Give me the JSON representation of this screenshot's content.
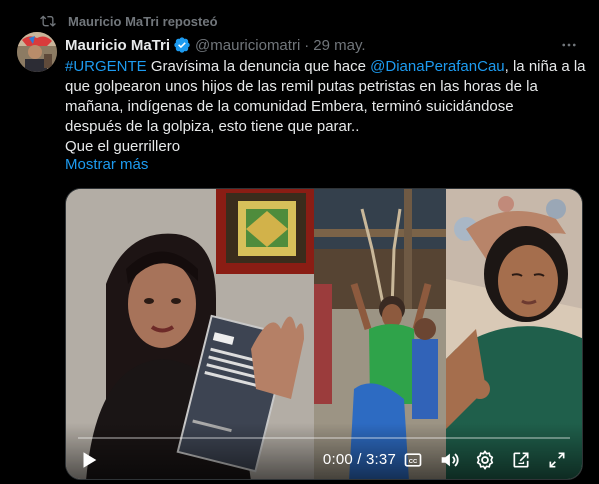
{
  "repost": {
    "text": "Mauricio MaTri reposteó",
    "icon": "repost-icon"
  },
  "tweet": {
    "author_name": "Mauricio MaTri",
    "handle": "@mauriciomatri",
    "separator": "·",
    "date": "29 may.",
    "verified": true,
    "lines": [
      {
        "parts": [
          {
            "text": "#URGENTE",
            "link": true
          },
          {
            "text": " Gravísima la denuncia que hace ",
            "link": false
          },
          {
            "text": "@DianaPerafanCau",
            "link": true
          },
          {
            "text": ", la niña a la",
            "link": false
          }
        ]
      },
      {
        "parts": [
          {
            "text": "que golpearon unos hijos de las remil putas petristas en las horas de la",
            "link": false
          }
        ]
      },
      {
        "parts": [
          {
            "text": "mañana, indígenas de la comunidad Embera, terminó suicidándose",
            "link": false
          }
        ]
      },
      {
        "parts": [
          {
            "text": "después de la golpiza, esto tiene que parar..",
            "link": false
          }
        ]
      },
      {
        "parts": [
          {
            "text": "Que el guerrillero",
            "link": false
          }
        ]
      }
    ],
    "show_more": "Mostrar más"
  },
  "media": {
    "book_title": "Constitución Política de Colombia",
    "book_brand": "LEGIS",
    "time": "0:00 / 3:37",
    "progress": 0.0,
    "icons": [
      "play-icon",
      "captions-icon",
      "volume-icon",
      "settings-icon",
      "popout-icon",
      "fullscreen-icon"
    ]
  },
  "colors": {
    "accent": "#1d9bf0",
    "muted": "#71767b",
    "text": "#e7e9ea",
    "background": "#000000"
  }
}
